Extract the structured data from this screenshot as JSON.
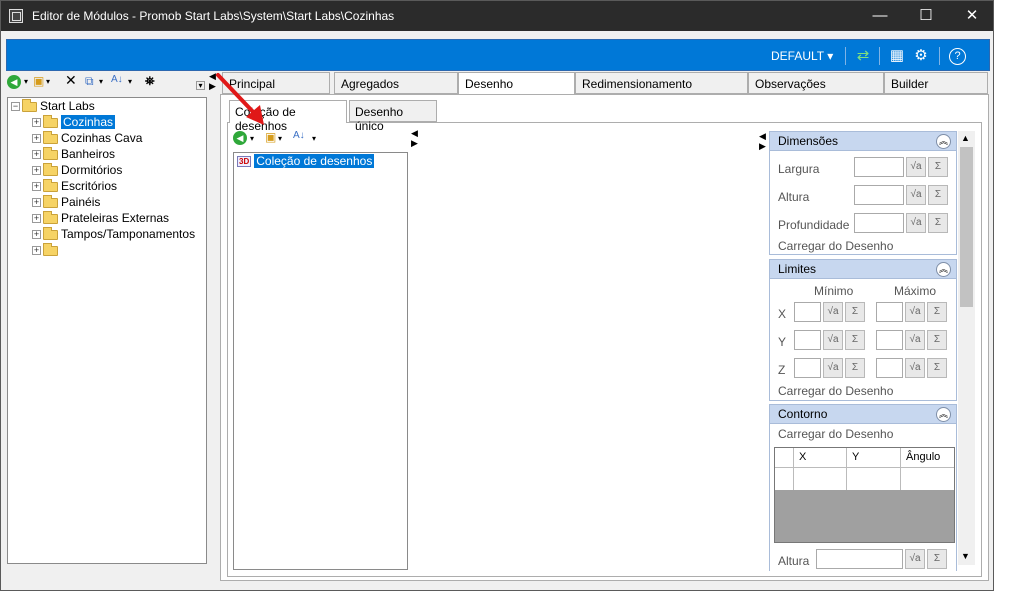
{
  "window": {
    "title": "Editor de Módulos - Promob Start Labs\\System\\Start Labs\\Cozinhas",
    "minimize": "—",
    "maximize": "☐",
    "close": "✕"
  },
  "toolbar": {
    "default_label": "DEFAULT ▾",
    "refresh_icon": "⇄",
    "layout_icon": "▦",
    "settings_icon": "⚙",
    "help_icon": "?"
  },
  "left_toolbar": {
    "back": "◀",
    "new": "▾",
    "delete": "✕",
    "copy": "⧉",
    "sort": "▾",
    "find": "⛯"
  },
  "tree": {
    "root": "Start Labs",
    "items": [
      "Cozinhas",
      "Cozinhas Cava",
      "Banheiros",
      "Dormitórios",
      "Escritórios",
      "Painéis",
      "Prateleiras Externas",
      "Tampos/Tamponamentos",
      ""
    ]
  },
  "tabs": [
    "Principal",
    "Agregados",
    "Desenho",
    "Redimensionamento",
    "Observações",
    "Builder"
  ],
  "subtabs": [
    "Coleção de desenhos",
    "Desenho único"
  ],
  "collection": {
    "item_badge": "3D",
    "item_label": "Coleção de desenhos"
  },
  "dimensoes": {
    "title": "Dimensões",
    "largura": "Largura",
    "altura": "Altura",
    "profundidade": "Profundidade",
    "carregar": "Carregar do Desenho"
  },
  "limites": {
    "title": "Limites",
    "minimo": "Mínimo",
    "maximo": "Máximo",
    "x": "X",
    "y": "Y",
    "z": "Z",
    "carregar": "Carregar do Desenho"
  },
  "contorno": {
    "title": "Contorno",
    "carregar": "Carregar do Desenho",
    "col_x": "X",
    "col_y": "Y",
    "col_angulo": "Ângulo",
    "altura": "Altura"
  },
  "icons": {
    "formula": "√a",
    "sum": "Σ",
    "collapse": "︽"
  }
}
